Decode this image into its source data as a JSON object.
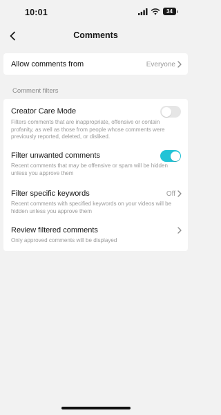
{
  "status_bar": {
    "time": "10:01",
    "battery": "34"
  },
  "header": {
    "title": "Comments"
  },
  "allow_comments": {
    "label": "Allow comments from",
    "value": "Everyone"
  },
  "section": {
    "label": "Comment filters"
  },
  "filters": [
    {
      "title": "Creator Care Mode",
      "description": "Filters comments that are inappropriate, offensive or contain profanity, as well as those from people whose comments were previously reported, deleted, or disliked.",
      "toggle": "off"
    },
    {
      "title": "Filter unwanted comments",
      "description": "Recent comments that may be offensive or spam will be hidden unless you approve them",
      "toggle": "on"
    },
    {
      "title": "Filter specific keywords",
      "value": "Off",
      "description": "Recent comments with specified keywords on your videos will be hidden unless you approve them"
    },
    {
      "title": "Review filtered comments",
      "description": "Only approved comments will be displayed"
    }
  ],
  "colors": {
    "accent": "#22c3d6",
    "toggle_off": "#e6e6e6",
    "background": "#f2f2f2",
    "secondary_text": "#9a9a9a"
  }
}
